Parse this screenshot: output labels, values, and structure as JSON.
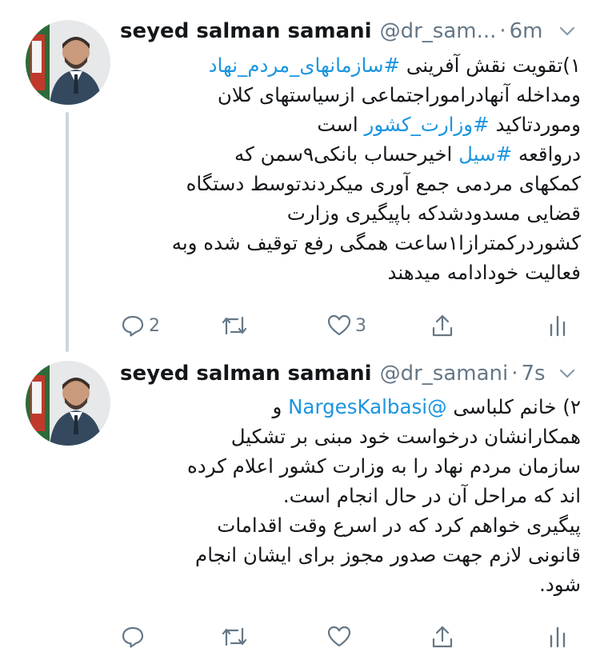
{
  "tweets": [
    {
      "name": "seyed salman samani",
      "handle": "@dr_sam...",
      "separator": "·",
      "time": "6m",
      "lines": [
        {
          "parts": [
            {
              "t": "۱)تقویت نقش آفرینی "
            },
            {
              "t": "#سازمانهای_مردم_نهاد",
              "link": true
            }
          ]
        },
        {
          "parts": [
            {
              "t": "ومداخله آنهادراموراجتماعی ازسیاستهای کلان"
            }
          ]
        },
        {
          "parts": [
            {
              "t": "وموردتاکید "
            },
            {
              "t": "#وزارت_کشور",
              "link": true
            },
            {
              "t": " است"
            }
          ]
        },
        {
          "parts": [
            {
              "t": "درواقعه "
            },
            {
              "t": "#سیل",
              "link": true
            },
            {
              "t": " اخیرحساب بانکی۹سمن که"
            }
          ]
        },
        {
          "parts": [
            {
              "t": "کمکهای مردمی جمع آوری میکردندتوسط دستگاه"
            }
          ]
        },
        {
          "parts": [
            {
              "t": "قضایی مسدودشدکه باپیگیری وزارت"
            }
          ]
        },
        {
          "parts": [
            {
              "t": "کشوردرکمترازا۱ساعت همگی رفع توقیف شده وبه"
            }
          ]
        },
        {
          "parts": [
            {
              "t": "فعالیت خودادامه میدهند"
            }
          ]
        }
      ],
      "actions": {
        "reply_count": "2",
        "retweet_count": "",
        "like_count": "3"
      }
    },
    {
      "name": "seyed salman samani",
      "handle": "@dr_samani",
      "separator": "·",
      "time": "7s",
      "lines": [
        {
          "parts": [
            {
              "t": "۲) خانم کلباسی "
            },
            {
              "t": "@NargesKalbasi",
              "link": true
            },
            {
              "t": " و"
            }
          ]
        },
        {
          "parts": [
            {
              "t": "همکارانشان درخواست خود مبنی بر تشکیل"
            }
          ]
        },
        {
          "parts": [
            {
              "t": "سازمان مردم نهاد را به وزارت کشور اعلام کرده"
            }
          ]
        },
        {
          "parts": [
            {
              "t": "اند که مراحل آن در حال انجام است."
            }
          ]
        },
        {
          "parts": [
            {
              "t": "پیگیری خواهم کرد که در اسرع وقت اقدامات"
            }
          ]
        },
        {
          "parts": [
            {
              "t": "قانونی لازم جهت صدور مجوز برای ایشان انجام"
            }
          ]
        },
        {
          "parts": [
            {
              "t": "شود."
            }
          ]
        }
      ],
      "actions": {
        "reply_count": "",
        "retweet_count": "",
        "like_count": ""
      }
    }
  ],
  "icons": {
    "reply": "reply-icon",
    "retweet": "retweet-icon",
    "like": "like-icon",
    "share": "share-icon",
    "analytics": "analytics-icon",
    "more": "chevron-down-icon"
  },
  "colors": {
    "link": "#1b95e0",
    "muted": "#657786",
    "text": "#14171a",
    "thread_line": "#ccd6dd"
  }
}
